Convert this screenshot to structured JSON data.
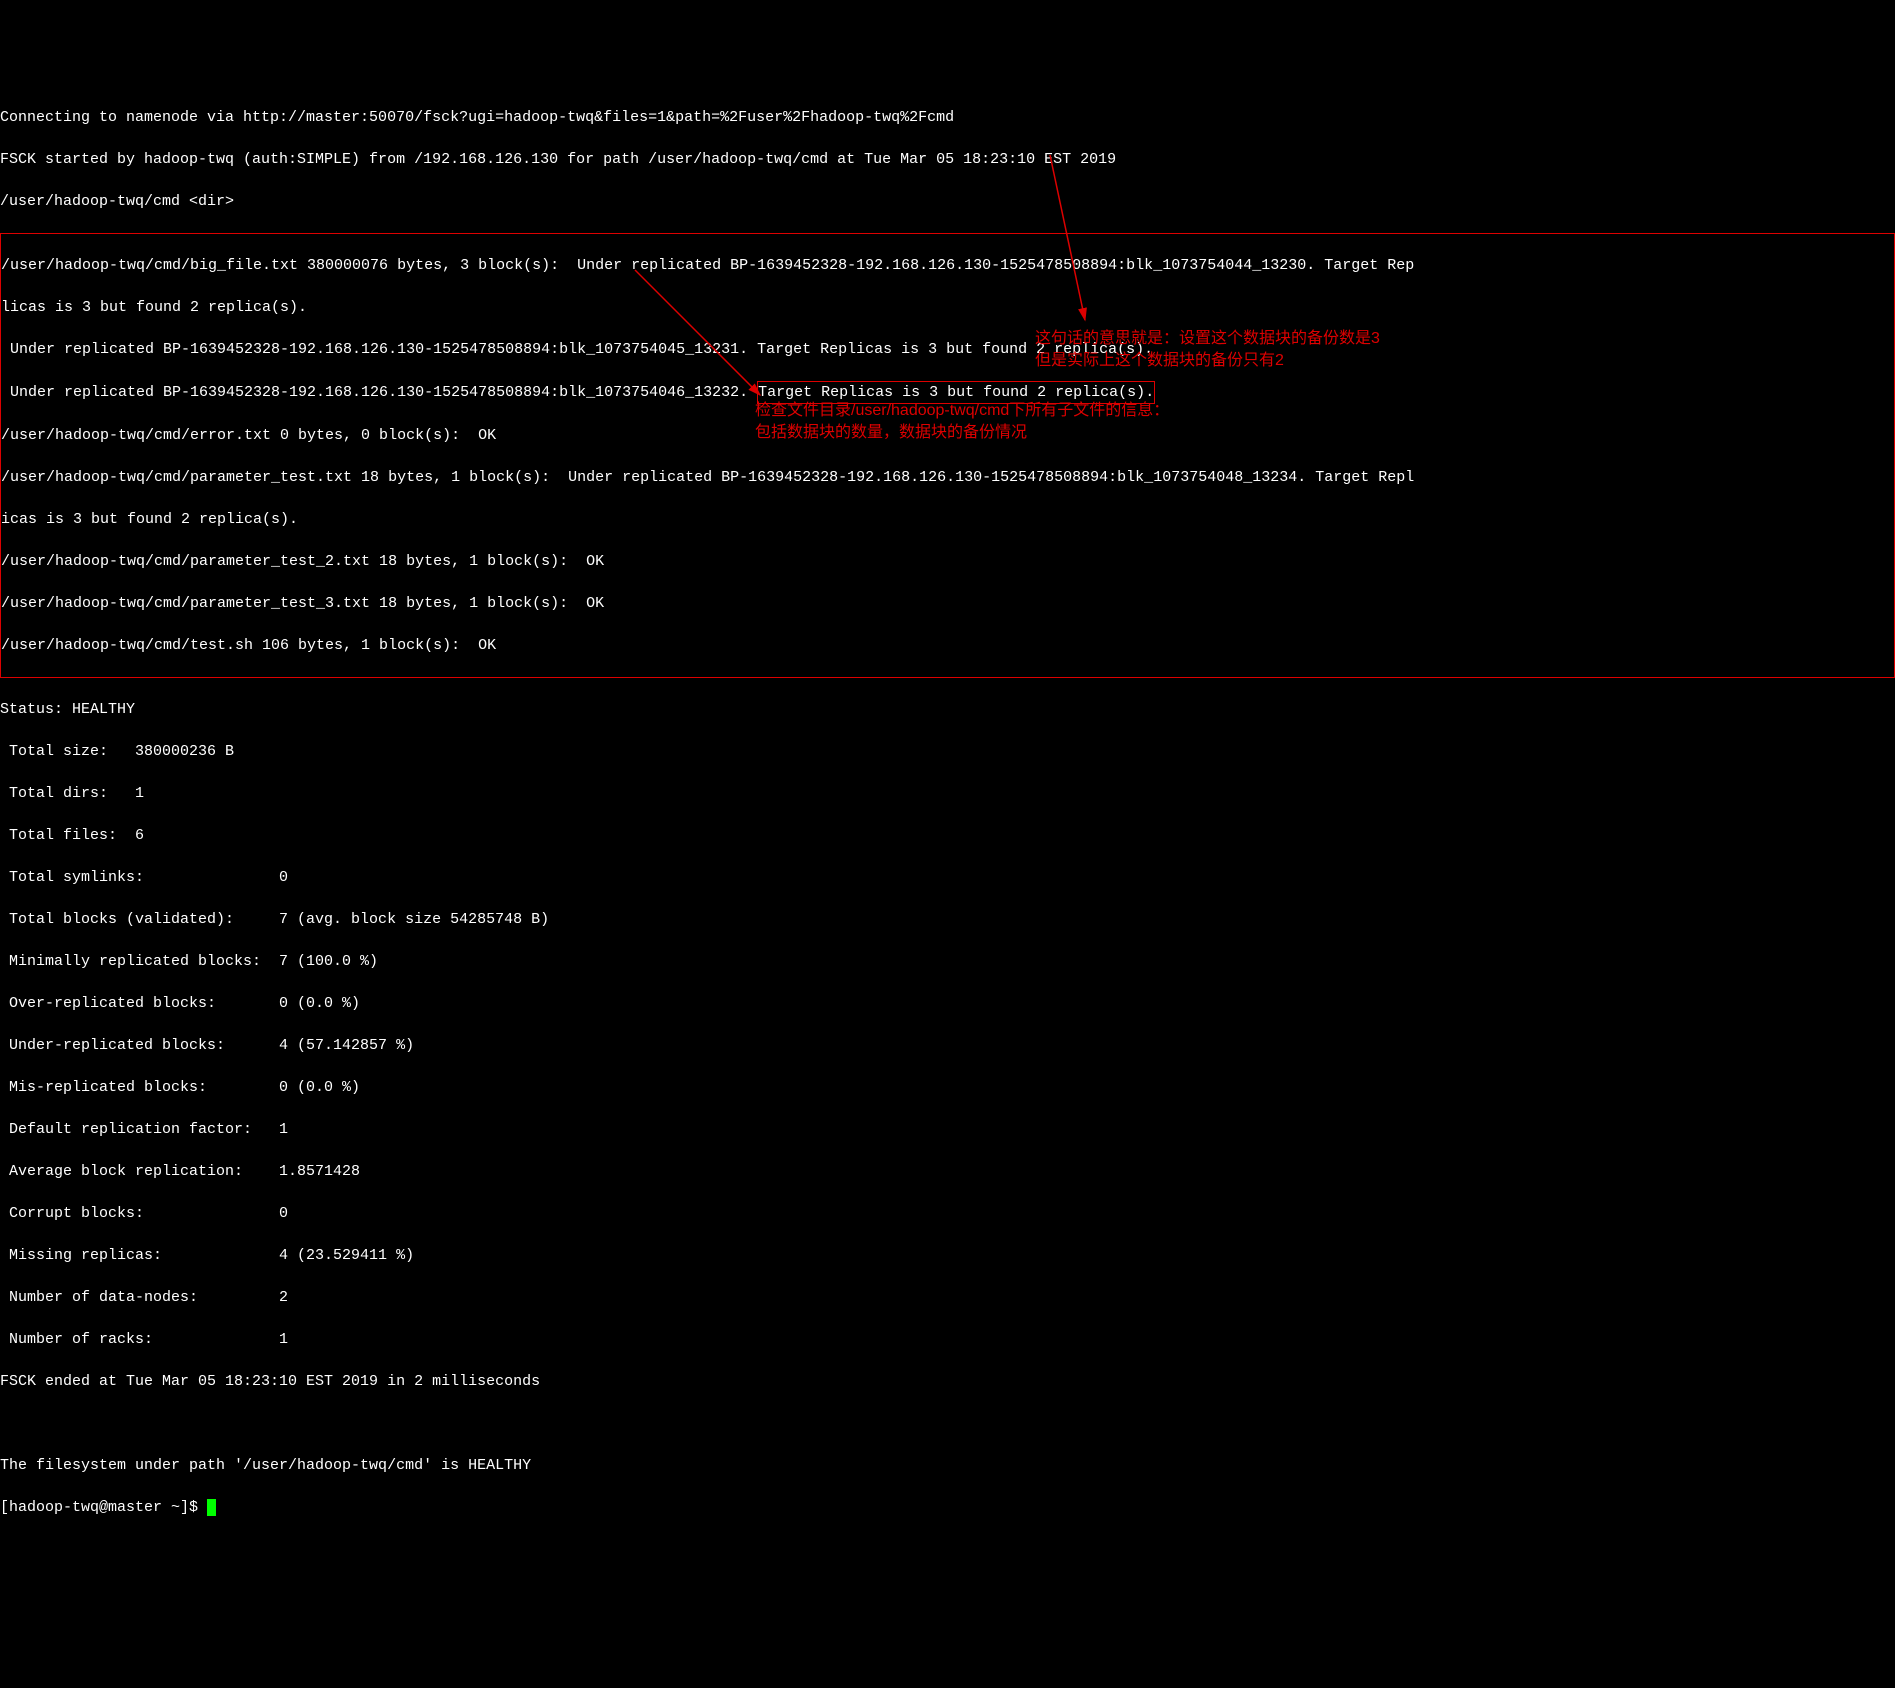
{
  "header": {
    "line1": "Connecting to namenode via http://master:50070/fsck?ugi=hadoop-twq&files=1&path=%2Fuser%2Fhadoop-twq%2Fcmd",
    "line2": "FSCK started by hadoop-twq (auth:SIMPLE) from /192.168.126.130 for path /user/hadoop-twq/cmd at Tue Mar 05 18:23:10 EST 2019",
    "line3": "/user/hadoop-twq/cmd <dir>"
  },
  "filebox": {
    "l1a": "/user/hadoop-twq/cmd/big_file.txt 380000076 bytes, 3 block(s):  Under replicated BP-1639452328-192.168.126.130-1525478508894:blk_1073754044_13230. Target Rep",
    "l1b": "licas is 3 but found 2 replica(s).",
    "l2": " Under replicated BP-1639452328-192.168.126.130-1525478508894:blk_1073754045_13231. Target Replicas is 3 but found 2 replica(s).",
    "l3a": " Under replicated BP-1639452328-192.168.126.130-1525478508894:blk_1073754046_13232. ",
    "l3b": "Target Replicas is 3 but found 2 replica(s).",
    "l4": "/user/hadoop-twq/cmd/error.txt 0 bytes, 0 block(s):  OK",
    "l5a": "/user/hadoop-twq/cmd/parameter_test.txt 18 bytes, 1 block(s):  Under replicated BP-1639452328-192.168.126.130-1525478508894:blk_1073754048_13234. Target Repl",
    "l5b": "icas is 3 but found 2 replica(s).",
    "l6": "/user/hadoop-twq/cmd/parameter_test_2.txt 18 bytes, 1 block(s):  OK",
    "l7": "/user/hadoop-twq/cmd/parameter_test_3.txt 18 bytes, 1 block(s):  OK",
    "l8": "/user/hadoop-twq/cmd/test.sh 106 bytes, 1 block(s):  OK"
  },
  "status": {
    "header": "Status: HEALTHY",
    "rows": [
      " Total size:   380000236 B",
      " Total dirs:   1",
      " Total files:  6",
      " Total symlinks:               0",
      " Total blocks (validated):     7 (avg. block size 54285748 B)",
      " Minimally replicated blocks:  7 (100.0 %)",
      " Over-replicated blocks:       0 (0.0 %)",
      " Under-replicated blocks:      4 (57.142857 %)",
      " Mis-replicated blocks:        0 (0.0 %)",
      " Default replication factor:   1",
      " Average block replication:    1.8571428",
      " Corrupt blocks:               0",
      " Missing replicas:             4 (23.529411 %)",
      " Number of data-nodes:         2",
      " Number of racks:              1"
    ],
    "ended": "FSCK ended at Tue Mar 05 18:23:10 EST 2019 in 2 milliseconds",
    "blank": "",
    "healthy": "The filesystem under path '/user/hadoop-twq/cmd' is HEALTHY",
    "prompt": "[hadoop-twq@master ~]$ "
  },
  "annotations": {
    "a1_l1": "这句话的意思就是：设置这个数据块的备份数是3",
    "a1_l2": "但是实际上这个数据块的备份只有2",
    "a2_l1": "检查文件目录/user/hadoop-twq/cmd下所有子文件的信息：",
    "a2_l2": "包括数据块的数量，数据块的备份情况"
  }
}
